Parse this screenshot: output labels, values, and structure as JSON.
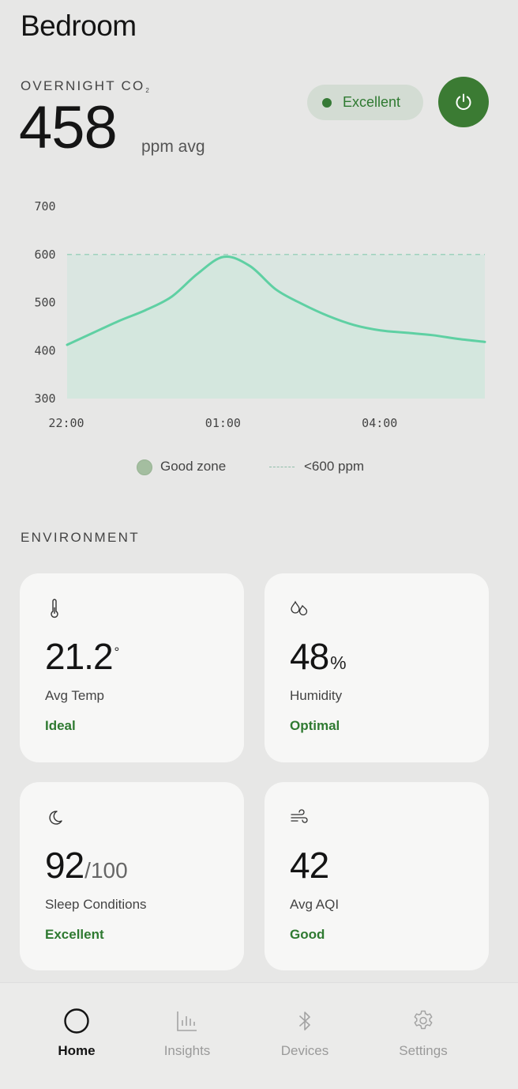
{
  "room": {
    "title": "Bedroom"
  },
  "co2": {
    "label": "OVERNIGHT CO",
    "label_sub": "2",
    "value": "458",
    "unit": "ppm avg",
    "status": "Excellent"
  },
  "chart_data": {
    "type": "area",
    "x": [
      "22:00",
      "22:30",
      "23:00",
      "23:30",
      "00:00",
      "00:30",
      "01:00",
      "01:30",
      "02:00",
      "02:30",
      "03:00",
      "03:30",
      "04:00",
      "04:30",
      "05:00",
      "05:30",
      "06:00"
    ],
    "x_ticks": [
      "22:00",
      "01:00",
      "04:00"
    ],
    "y_ticks": [
      "700",
      "600",
      "500",
      "400",
      "300"
    ],
    "ylim": [
      300,
      700
    ],
    "series": [
      {
        "values": [
          412,
          437,
          462,
          484,
          512,
          560,
          595,
          576,
          527,
          497,
          472,
          453,
          442,
          437,
          432,
          424,
          418
        ]
      }
    ],
    "threshold": 600,
    "legend": {
      "good_zone": "Good zone",
      "threshold": "<600 ppm"
    },
    "colors": {
      "line": "#5fd0a3",
      "fill": "#d8e6e0",
      "threshold": "#9fd1bd"
    }
  },
  "environment": {
    "title": "ENVIRONMENT",
    "cards": [
      {
        "icon": "thermometer-icon",
        "value": "21.2",
        "unit": "°",
        "label": "Avg Temp",
        "status": "Ideal"
      },
      {
        "icon": "droplets-icon",
        "value": "48",
        "unit": "%",
        "label": "Humidity",
        "status": "Optimal"
      },
      {
        "icon": "moon-icon",
        "value": "92",
        "unit": "/100",
        "label": "Sleep Conditions",
        "status": "Excellent"
      },
      {
        "icon": "wind-icon",
        "value": "42",
        "unit": "",
        "label": "Avg AQI",
        "status": "Good"
      }
    ]
  },
  "nav": {
    "items": [
      {
        "label": "Home",
        "icon": "home-circle-icon",
        "active": true
      },
      {
        "label": "Insights",
        "icon": "bar-chart-icon",
        "active": false
      },
      {
        "label": "Devices",
        "icon": "bluetooth-icon",
        "active": false
      },
      {
        "label": "Settings",
        "icon": "gear-icon",
        "active": false
      }
    ]
  },
  "colors": {
    "accent": "#3b7b33",
    "status_text": "#2f7a31",
    "background": "#e7e7e6",
    "card": "#f7f7f6"
  }
}
